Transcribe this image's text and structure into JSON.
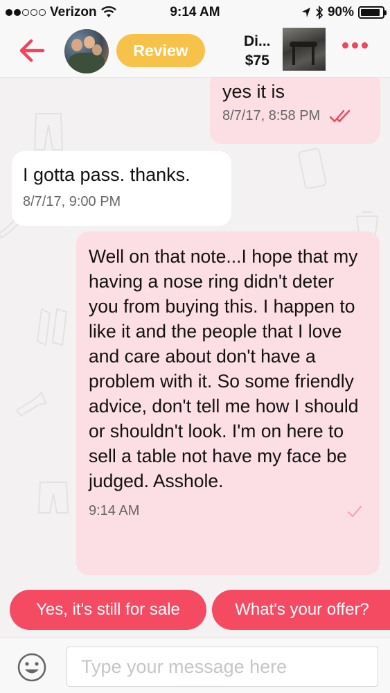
{
  "status_bar": {
    "carrier": "Verizon",
    "time": "9:14 AM",
    "battery": "90%",
    "battery_level": 0.9
  },
  "nav": {
    "review_label": "Review",
    "listing_title": "Di...",
    "listing_price": "$75"
  },
  "messages": [
    {
      "side": "me",
      "text": "yes it is",
      "timestamp": "8/7/17, 8:58 PM",
      "status": "read"
    },
    {
      "side": "them",
      "text": "I gotta pass. thanks.",
      "timestamp": "8/7/17, 9:00 PM"
    },
    {
      "side": "me",
      "text": "Well on that note...I hope that my having a nose ring didn't deter you from buying this. I happen to like it and the people that I love and care about don't have a problem with it. So some friendly advice, don't tell me how I should or shouldn't look. I'm on here to sell a table not have my face be judged. Asshole.",
      "timestamp": "9:14 AM",
      "status": "sent"
    }
  ],
  "quick_replies": [
    "Yes, it's still for sale",
    "What's your offer?"
  ],
  "input": {
    "placeholder": "Type your message here"
  },
  "colors": {
    "accent": "#f44a62",
    "review": "#f6c24a",
    "my_bubble": "#fcdfe4",
    "their_bubble": "#ffffff",
    "background": "#f3f1f1"
  }
}
